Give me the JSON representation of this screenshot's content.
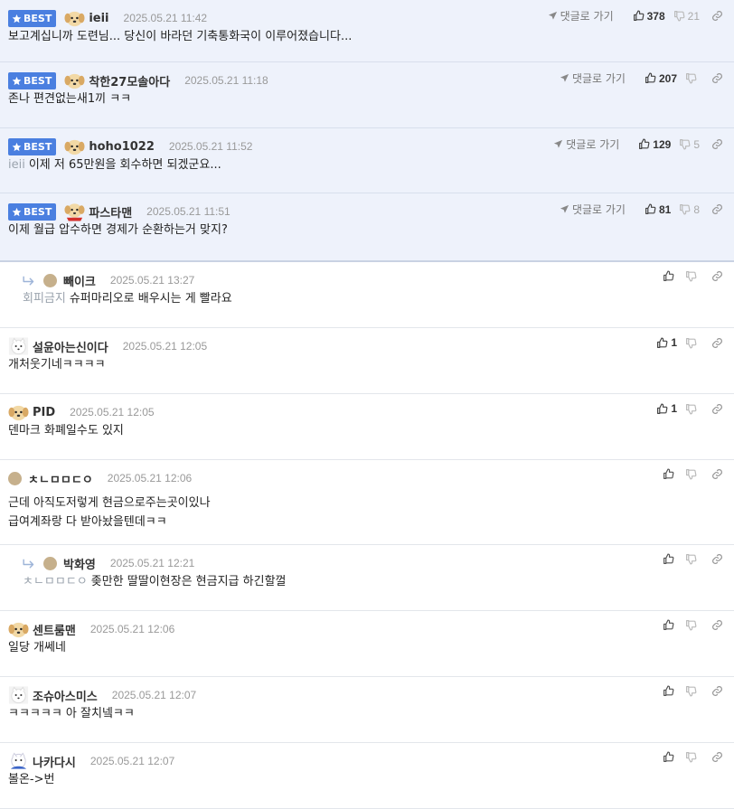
{
  "ui": {
    "best_label": "BEST",
    "goto_label": "댓글로 가기"
  },
  "comments": [
    {
      "best": true,
      "nick": "ieii",
      "date": "2025.05.21 11:42",
      "text": "보고계십니까 도련님... 당신이 바라던 기축통화국이 이루어졌습니다...",
      "up": "378",
      "down": "21",
      "avatar": "dog",
      "h": 69
    },
    {
      "best": true,
      "nick": "착한27모솔아다",
      "date": "2025.05.21 11:18",
      "text": "존나 편견없는새1끼 ㅋㅋ",
      "up": "207",
      "down": "",
      "avatar": "dog",
      "h": 73
    },
    {
      "best": true,
      "nick": "hoho1022",
      "date": "2025.05.21 11:52",
      "mention": "ieii",
      "text": "이제 저 65만원을 회수하면 되겠군요...",
      "up": "129",
      "down": "5",
      "avatar": "dog",
      "h": 72
    },
    {
      "best": true,
      "nick": "파스타맨",
      "date": "2025.05.21 11:51",
      "text": "이제 월급 압수하면 경제가 순환하는거 맞지?",
      "up": "81",
      "down": "8",
      "avatar": "dog-red",
      "h": 76,
      "last": true
    },
    {
      "reply": true,
      "nick": "빼이크",
      "date": "2025.05.21 13:27",
      "mention": "회피금지",
      "text": "슈퍼마리오로 배우시는 게 빨라요",
      "up": "",
      "down": "",
      "avatar": "dot",
      "h": 73
    },
    {
      "nick": "설윤아는신이다",
      "date": "2025.05.21 12:05",
      "text": "개처웃기네ㅋㅋㅋㅋ",
      "up": "1",
      "down": "",
      "avatar": "white",
      "h": 73
    },
    {
      "nick": "PID",
      "date": "2025.05.21 12:05",
      "text": "덴마크 화폐일수도 있지",
      "up": "1",
      "down": "",
      "avatar": "dog",
      "h": 73
    },
    {
      "nick": "ㅊㄴㅁㅁㄷㅇ",
      "date": "2025.05.21 12:06",
      "text": "근데 아직도저렇게 현금으로주는곳이있나\n급여계좌랑 다 받아놨을텐데ㅋㅋ",
      "up": "",
      "down": "",
      "avatar": "dot",
      "h": 94
    },
    {
      "reply": true,
      "nick": "박화영",
      "date": "2025.05.21 12:21",
      "mention": "ㅊㄴㅁㅁㄷㅇ",
      "text": "좆만한 딸딸이현장은 현금지급 하긴할껄",
      "up": "",
      "down": "",
      "avatar": "dot",
      "h": 73
    },
    {
      "nick": "센트룸맨",
      "date": "2025.05.21 12:06",
      "text": "일당 개쎄네",
      "up": "",
      "down": "",
      "avatar": "dog",
      "h": 73
    },
    {
      "nick": "조슈아스미스",
      "date": "2025.05.21 12:07",
      "text": "ㅋㅋㅋㅋㅋ 아 잘치넼ㅋㅋ",
      "up": "",
      "down": "",
      "avatar": "white",
      "h": 73
    },
    {
      "nick": "나카다시",
      "date": "2025.05.21 12:07",
      "text": "볼온->번",
      "up": "",
      "down": "",
      "avatar": "white-blue",
      "h": 73
    }
  ]
}
